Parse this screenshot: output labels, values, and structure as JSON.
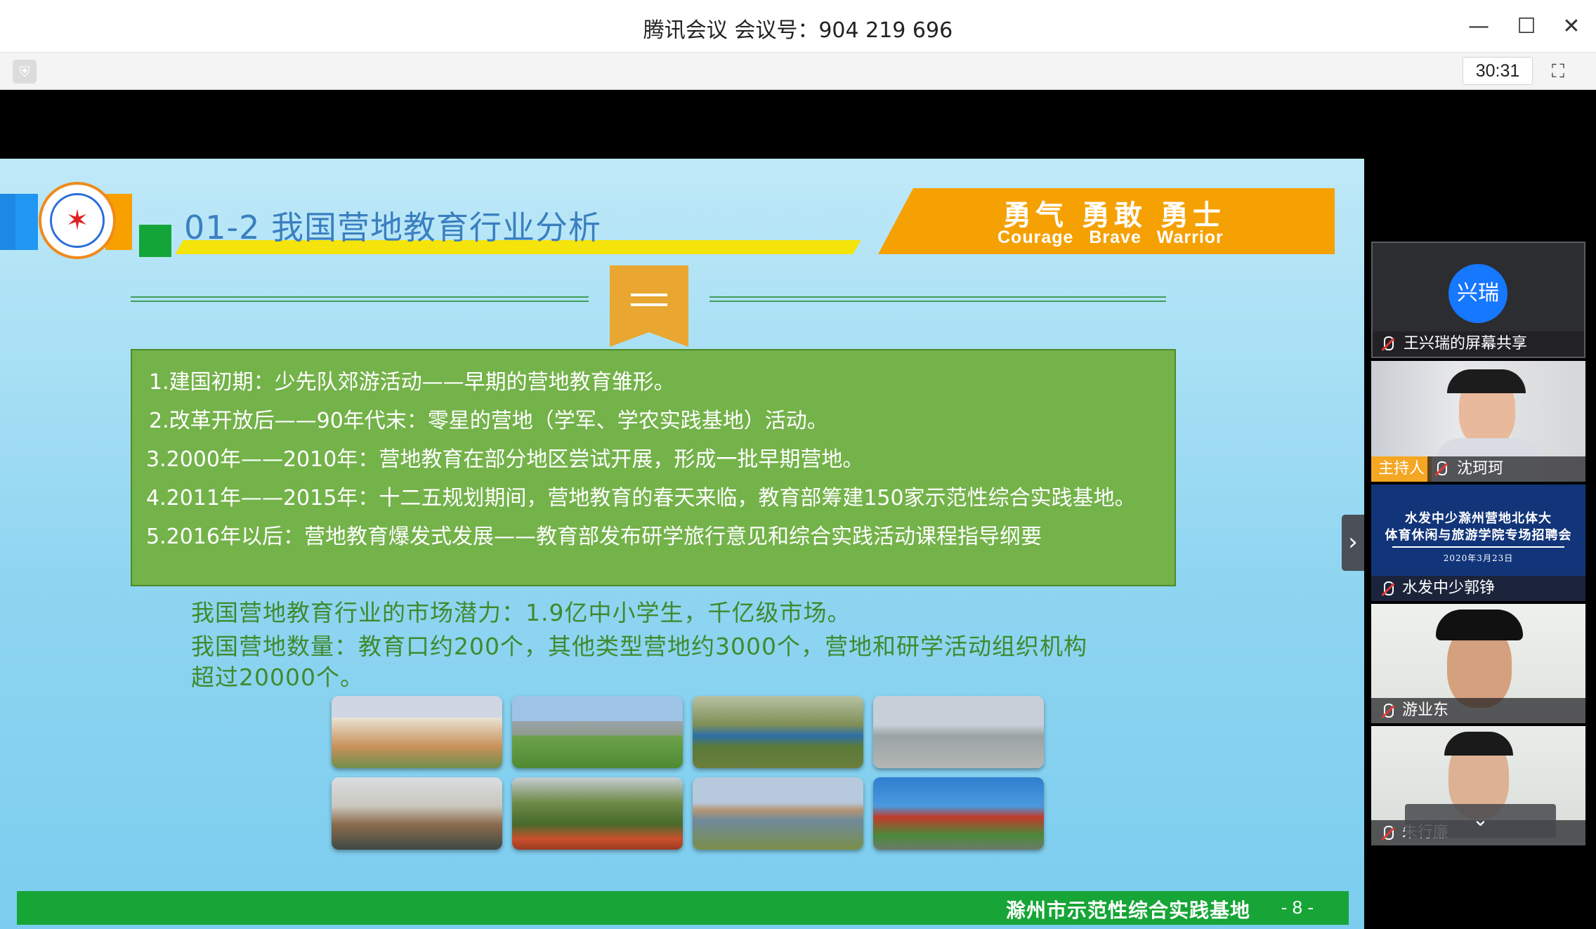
{
  "window": {
    "title": "腾讯会议 会议号：904 219 696",
    "timer": "30:31",
    "minimize_icon": "minimize-icon",
    "maximize_icon": "maximize-icon",
    "close_icon": "close-icon"
  },
  "slide": {
    "heading": "01-2 我国营地教育行业分析",
    "banner_cn": "勇气 勇敢 勇士",
    "banner_en": "Courage Brave Warrior",
    "points": [
      " 1.建国初期：少先队郊游活动——早期的营地教育雏形。",
      " 2.改革开放后——90年代末：零星的营地（学军、学农实践基地）活动。",
      "3.2000年——2010年：营地教育在部分地区尝试开展，形成一批早期营地。",
      "4.2011年——2015年：十二五规划期间，营地教育的春天来临，教育部筹建150家示范性综合实践基地。",
      "5.2016年以后：营地教育爆发式发展——教育部发布研学旅行意见和综合实践活动课程指导纲要"
    ],
    "notes": [
      "我国营地教育行业的市场潜力：1.9亿中小学生，千亿级市场。",
      "我国营地数量：教育口约200个，其他类型营地约3000个，营地和研学活动组织机构",
      "超过20000个。"
    ],
    "footer_text": "滁州市示范性综合实践基地",
    "page_number": "- 8 -"
  },
  "participants": [
    {
      "name": "兴瑞",
      "label": "王兴瑞的屏幕共享"
    },
    {
      "name": "沈珂珂",
      "role": "主持人"
    },
    {
      "name": "水发中少郭铮",
      "poster_line1": "水发中少滁州营地北体大",
      "poster_line2": "体育休闲与旅游学院专场招聘会",
      "poster_date": "2020年3月23日"
    },
    {
      "name": "游业东"
    },
    {
      "name": "朱行廉"
    }
  ]
}
